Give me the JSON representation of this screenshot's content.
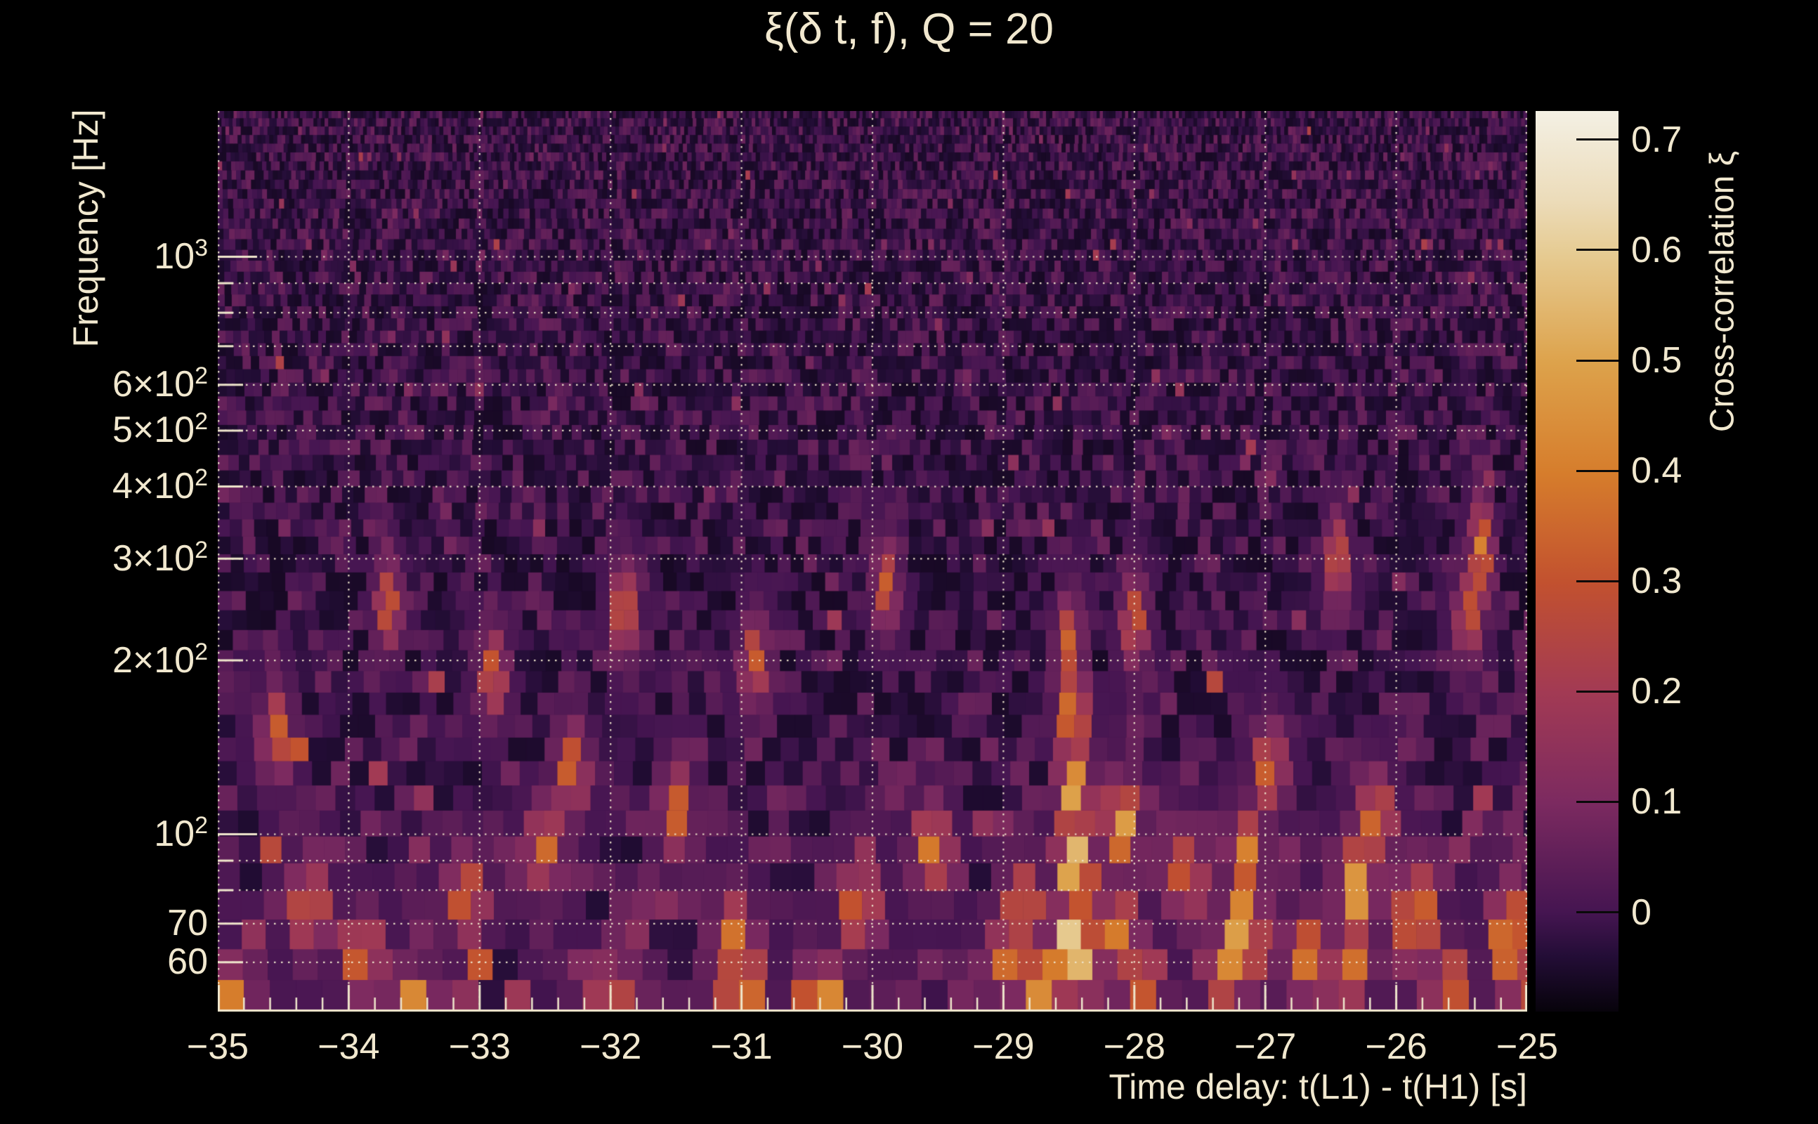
{
  "figure": {
    "background": "#000000",
    "text_color": "#F1E8CF",
    "grid_color": "#EFE6CC",
    "colorbar_tick_color": "#0a0a0a"
  },
  "chart_data": {
    "type": "heatmap",
    "title": "ξ(δ t, f), Q = 20",
    "xlabel": "Time delay: t(L1) - t(H1) [s]",
    "ylabel": "Frequency [Hz]",
    "colorbar_label": "Cross-correlation ξ",
    "xlim": [
      -35,
      -25
    ],
    "ylim_hz": [
      49.2,
      1790
    ],
    "yscale": "log",
    "grid": true,
    "x_ticks": [
      {
        "t": -35,
        "label": "−35"
      },
      {
        "t": -34,
        "label": "−34"
      },
      {
        "t": -33,
        "label": "−33"
      },
      {
        "t": -32,
        "label": "−32"
      },
      {
        "t": -31,
        "label": "−31"
      },
      {
        "t": -30,
        "label": "−30"
      },
      {
        "t": -29,
        "label": "−29"
      },
      {
        "t": -28,
        "label": "−28"
      },
      {
        "t": -27,
        "label": "−27"
      },
      {
        "t": -26,
        "label": "−26"
      },
      {
        "t": -25,
        "label": "−25"
      }
    ],
    "x_minor_step": 0.2,
    "y_tick_labels": [
      {
        "f": 1000,
        "base": "10",
        "sup": "3"
      },
      {
        "f": 600,
        "base": "6×10",
        "sup": "2"
      },
      {
        "f": 500,
        "base": "5×10",
        "sup": "2"
      },
      {
        "f": 400,
        "base": "4×10",
        "sup": "2"
      },
      {
        "f": 300,
        "base": "3×10",
        "sup": "2"
      },
      {
        "f": 200,
        "base": "2×10",
        "sup": "2"
      },
      {
        "f": 100,
        "base": "10",
        "sup": "2"
      },
      {
        "f": 70,
        "base": "70",
        "sup": ""
      },
      {
        "f": 60,
        "base": "60",
        "sup": ""
      }
    ],
    "y_gridlines_hz": [
      60,
      70,
      80,
      90,
      100,
      200,
      300,
      400,
      500,
      600,
      700,
      800,
      900,
      1000
    ],
    "colorbar": {
      "vmin": -0.09,
      "vmax": 0.726,
      "ticks": [
        {
          "v": 0.7,
          "label": "0.7"
        },
        {
          "v": 0.6,
          "label": "0.6"
        },
        {
          "v": 0.5,
          "label": "0.5"
        },
        {
          "v": 0.4,
          "label": "0.4"
        },
        {
          "v": 0.3,
          "label": "0.3"
        },
        {
          "v": 0.2,
          "label": "0.2"
        },
        {
          "v": 0.1,
          "label": "0.1"
        },
        {
          "v": 0.0,
          "label": "0"
        }
      ]
    },
    "colormap_stops": [
      [
        0.0,
        "#07030b"
      ],
      [
        0.061,
        "#230d36"
      ],
      [
        0.11,
        "#451551"
      ],
      [
        0.232,
        "#7c2a60"
      ],
      [
        0.354,
        "#a23a54"
      ],
      [
        0.476,
        "#c2512f"
      ],
      [
        0.598,
        "#d67d2c"
      ],
      [
        0.72,
        "#dda24b"
      ],
      [
        0.841,
        "#e6cb92"
      ],
      [
        0.902,
        "#ecdcba"
      ],
      [
        1.0,
        "#f4f0e4"
      ]
    ],
    "hotspots": [
      {
        "t": -28.45,
        "f": 64,
        "xi": 0.74,
        "dt": 0.05,
        "df": 0.045
      },
      {
        "t": -28.45,
        "f": 88,
        "xi": 0.62,
        "dt": 0.045,
        "df": 0.06
      },
      {
        "t": -28.46,
        "f": 118,
        "xi": 0.52,
        "dt": 0.045,
        "df": 0.06
      },
      {
        "t": -28.47,
        "f": 160,
        "xi": 0.44,
        "dt": 0.05,
        "df": 0.06
      },
      {
        "t": -28.5,
        "f": 215,
        "xi": 0.34,
        "dt": 0.05,
        "df": 0.05
      },
      {
        "t": -28.68,
        "f": 56,
        "xi": 0.62,
        "dt": 0.06,
        "df": 0.04
      },
      {
        "t": -28.85,
        "f": 75,
        "xi": 0.38,
        "dt": 0.05,
        "df": 0.05
      },
      {
        "t": -28.1,
        "f": 104,
        "xi": 0.52,
        "dt": 0.04,
        "df": 0.05
      },
      {
        "t": -28.12,
        "f": 68,
        "xi": 0.4,
        "dt": 0.05,
        "df": 0.05
      },
      {
        "t": -27.95,
        "f": 56,
        "xi": 0.4,
        "dt": 0.06,
        "df": 0.04
      },
      {
        "t": -27.17,
        "f": 68,
        "xi": 0.55,
        "dt": 0.05,
        "df": 0.06
      },
      {
        "t": -27.3,
        "f": 58,
        "xi": 0.46,
        "dt": 0.06,
        "df": 0.04
      },
      {
        "t": -27.15,
        "f": 92,
        "xi": 0.42,
        "dt": 0.04,
        "df": 0.05
      },
      {
        "t": -26.97,
        "f": 130,
        "xi": 0.36,
        "dt": 0.04,
        "df": 0.05
      },
      {
        "t": -26.3,
        "f": 80,
        "xi": 0.5,
        "dt": 0.05,
        "df": 0.06
      },
      {
        "t": -26.37,
        "f": 59,
        "xi": 0.42,
        "dt": 0.06,
        "df": 0.04
      },
      {
        "t": -26.15,
        "f": 106,
        "xi": 0.4,
        "dt": 0.04,
        "df": 0.05
      },
      {
        "t": -25.85,
        "f": 72,
        "xi": 0.46,
        "dt": 0.05,
        "df": 0.06
      },
      {
        "t": -25.12,
        "f": 66,
        "xi": 0.5,
        "dt": 0.05,
        "df": 0.06
      },
      {
        "t": -25.35,
        "f": 310,
        "xi": 0.42,
        "dt": 0.035,
        "df": 0.06
      },
      {
        "t": -25.45,
        "f": 240,
        "xi": 0.33,
        "dt": 0.035,
        "df": 0.05
      },
      {
        "t": -25.6,
        "f": 55,
        "xi": 0.38,
        "dt": 0.06,
        "df": 0.04
      },
      {
        "t": -30.4,
        "f": 52,
        "xi": 0.55,
        "dt": 0.08,
        "df": 0.035
      },
      {
        "t": -31.0,
        "f": 55,
        "xi": 0.52,
        "dt": 0.07,
        "df": 0.04
      },
      {
        "t": -31.05,
        "f": 66,
        "xi": 0.38,
        "dt": 0.05,
        "df": 0.05
      },
      {
        "t": -33.5,
        "f": 51,
        "xi": 0.45,
        "dt": 0.08,
        "df": 0.03
      },
      {
        "t": -34.9,
        "f": 52,
        "xi": 0.4,
        "dt": 0.07,
        "df": 0.03
      },
      {
        "t": -32.0,
        "f": 53,
        "xi": 0.33,
        "dt": 0.06,
        "df": 0.035
      },
      {
        "t": -31.9,
        "f": 245,
        "xi": 0.38,
        "dt": 0.035,
        "df": 0.05
      },
      {
        "t": -33.7,
        "f": 250,
        "xi": 0.34,
        "dt": 0.035,
        "df": 0.05
      },
      {
        "t": -32.9,
        "f": 190,
        "xi": 0.34,
        "dt": 0.04,
        "df": 0.05
      },
      {
        "t": -30.9,
        "f": 200,
        "xi": 0.33,
        "dt": 0.04,
        "df": 0.05
      },
      {
        "t": -29.9,
        "f": 270,
        "xi": 0.33,
        "dt": 0.035,
        "df": 0.05
      },
      {
        "t": -26.45,
        "f": 300,
        "xi": 0.35,
        "dt": 0.035,
        "df": 0.05
      },
      {
        "t": -28.0,
        "f": 235,
        "xi": 0.34,
        "dt": 0.035,
        "df": 0.05
      },
      {
        "t": -29.55,
        "f": 95,
        "xi": 0.4,
        "dt": 0.045,
        "df": 0.05
      },
      {
        "t": -29.0,
        "f": 60,
        "xi": 0.36,
        "dt": 0.06,
        "df": 0.04
      },
      {
        "t": -30.1,
        "f": 75,
        "xi": 0.38,
        "dt": 0.05,
        "df": 0.05
      },
      {
        "t": -33.9,
        "f": 62,
        "xi": 0.38,
        "dt": 0.06,
        "df": 0.045
      },
      {
        "t": -34.3,
        "f": 75,
        "xi": 0.36,
        "dt": 0.05,
        "df": 0.05
      },
      {
        "t": -32.5,
        "f": 95,
        "xi": 0.36,
        "dt": 0.05,
        "df": 0.05
      },
      {
        "t": -33.1,
        "f": 78,
        "xi": 0.36,
        "dt": 0.05,
        "df": 0.05
      },
      {
        "t": -32.3,
        "f": 130,
        "xi": 0.36,
        "dt": 0.045,
        "df": 0.05
      },
      {
        "t": -31.5,
        "f": 110,
        "xi": 0.36,
        "dt": 0.045,
        "df": 0.05
      },
      {
        "t": -34.55,
        "f": 150,
        "xi": 0.34,
        "dt": 0.04,
        "df": 0.05
      },
      {
        "t": -27.6,
        "f": 85,
        "xi": 0.36,
        "dt": 0.05,
        "df": 0.05
      },
      {
        "t": -26.7,
        "f": 62,
        "xi": 0.4,
        "dt": 0.06,
        "df": 0.045
      }
    ],
    "texture": {
      "seed": 1337,
      "base_min": -0.06,
      "base_span": 0.13,
      "spike_prob_floor": 0.03,
      "spike_prob_gain": 0.3,
      "spike_mag": 0.3
    }
  }
}
